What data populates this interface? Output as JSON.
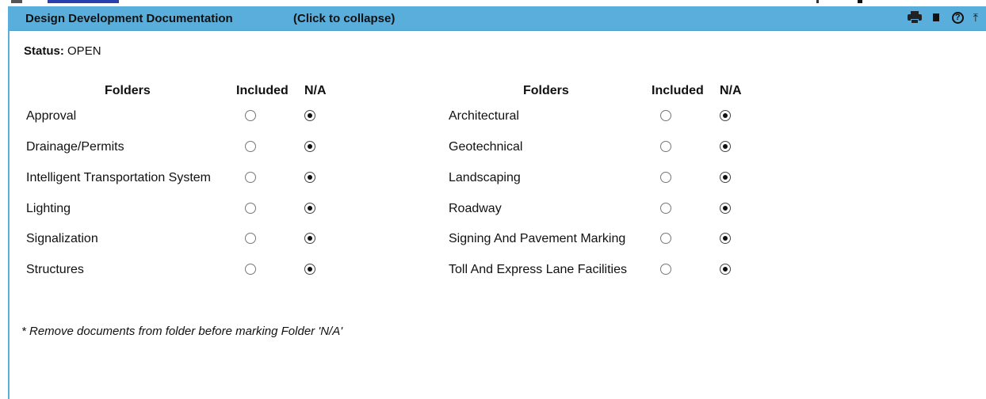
{
  "header": {
    "title": "Design Development Documentation",
    "collapse_label": "(Click to collapse)",
    "accent_color": "#5aaedc",
    "icons": [
      "print-icon",
      "square-icon",
      "help-icon",
      "pin-icon"
    ],
    "help_glyph": "?",
    "pin_glyph": "⤒"
  },
  "status": {
    "label": "Status:",
    "value": "OPEN"
  },
  "columns": {
    "folders": "Folders",
    "included": "Included",
    "na": "N/A"
  },
  "left_folders": [
    {
      "name": "Approval",
      "selected": "na"
    },
    {
      "name": "Drainage/Permits",
      "selected": "na"
    },
    {
      "name": "Intelligent Transportation System",
      "selected": "na"
    },
    {
      "name": "Lighting",
      "selected": "na"
    },
    {
      "name": "Signalization",
      "selected": "na"
    },
    {
      "name": "Structures",
      "selected": "na"
    }
  ],
  "right_folders": [
    {
      "name": "Architectural",
      "selected": "na"
    },
    {
      "name": "Geotechnical",
      "selected": "na"
    },
    {
      "name": "Landscaping",
      "selected": "na"
    },
    {
      "name": "Roadway",
      "selected": "na"
    },
    {
      "name": "Signing And Pavement Marking",
      "selected": "na"
    },
    {
      "name": "Toll And Express Lane Facilities",
      "selected": "na"
    }
  ],
  "note": "* Remove documents from folder before marking Folder 'N/A'"
}
